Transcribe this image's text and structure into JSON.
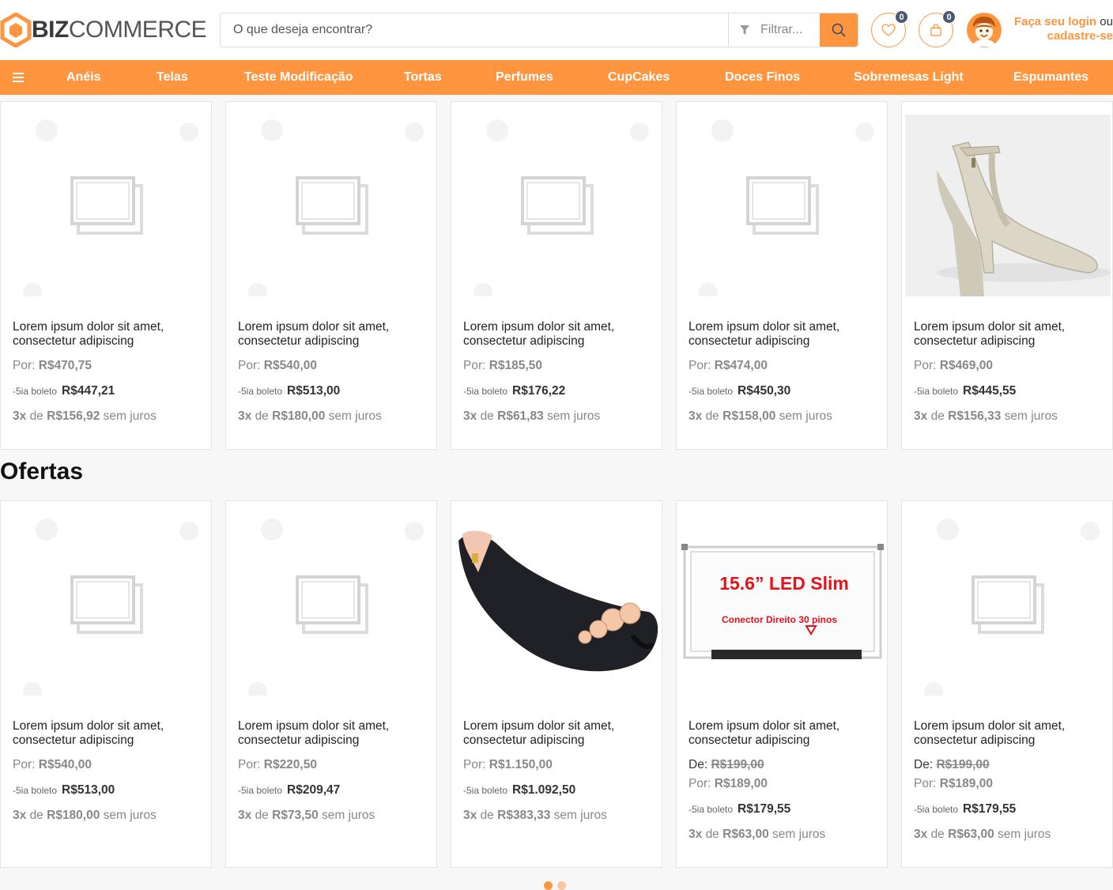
{
  "header": {
    "logo": {
      "bold": "BIZ",
      "light": "COMMERCE"
    },
    "search_placeholder": "O que deseja encontrar?",
    "filter_label": "Filtrar...",
    "wishlist_count": "0",
    "cart_count": "0",
    "login_link": "Faça seu login",
    "login_or": " ou",
    "register_link": "cadastre-se"
  },
  "nav": {
    "items": [
      "Anéis",
      "Telas",
      "Teste Modificação",
      "Tortas",
      "Perfumes",
      "CupCakes",
      "Doces Finos",
      "Sobremesas Light",
      "Espumantes"
    ]
  },
  "row1": [
    {
      "title": "Lorem ipsum dolor sit amet, consectetur adipiscing",
      "por_label": "Por:",
      "por": "R$470,75",
      "boleto_label": "-5ia boleto",
      "boleto": "R$447,21",
      "inst_n": "3x",
      "inst_de": "de",
      "inst": "R$156,92",
      "inst_suffix": "sem juros",
      "image": "placeholder"
    },
    {
      "title": "Lorem ipsum dolor sit amet, consectetur adipiscing",
      "por_label": "Por:",
      "por": "R$540,00",
      "boleto_label": "-5ia boleto",
      "boleto": "R$513,00",
      "inst_n": "3x",
      "inst_de": "de",
      "inst": "R$180,00",
      "inst_suffix": "sem juros",
      "image": "placeholder"
    },
    {
      "title": "Lorem ipsum dolor sit amet, consectetur adipiscing",
      "por_label": "Por:",
      "por": "R$185,50",
      "boleto_label": "-5ia boleto",
      "boleto": "R$176,22",
      "inst_n": "3x",
      "inst_de": "de",
      "inst": "R$61,83",
      "inst_suffix": "sem juros",
      "image": "placeholder"
    },
    {
      "title": "Lorem ipsum dolor sit amet, consectetur adipiscing",
      "por_label": "Por:",
      "por": "R$474,00",
      "boleto_label": "-5ia boleto",
      "boleto": "R$450,30",
      "inst_n": "3x",
      "inst_de": "de",
      "inst": "R$158,00",
      "inst_suffix": "sem juros",
      "image": "placeholder"
    },
    {
      "title": "Lorem ipsum dolor sit amet, consectetur adipiscing",
      "por_label": "Por:",
      "por": "R$469,00",
      "boleto_label": "-5ia boleto",
      "boleto": "R$445,55",
      "inst_n": "3x",
      "inst_de": "de",
      "inst": "R$156,33",
      "inst_suffix": "sem juros",
      "image": "sandal"
    }
  ],
  "offers": {
    "title": "Ofertas",
    "items": [
      {
        "title": "Lorem ipsum dolor sit amet, consectetur adipiscing",
        "por_label": "Por:",
        "por": "R$540,00",
        "boleto_label": "-5ia boleto",
        "boleto": "R$513,00",
        "inst_n": "3x",
        "inst_de": "de",
        "inst": "R$180,00",
        "inst_suffix": "sem juros",
        "image": "placeholder"
      },
      {
        "title": "Lorem ipsum dolor sit amet, consectetur adipiscing",
        "por_label": "Por:",
        "por": "R$220,50",
        "boleto_label": "-5ia boleto",
        "boleto": "R$209,47",
        "inst_n": "3x",
        "inst_de": "de",
        "inst": "R$73,50",
        "inst_suffix": "sem juros",
        "image": "placeholder"
      },
      {
        "title": "Lorem ipsum dolor sit amet, consectetur adipiscing",
        "por_label": "Por:",
        "por": "R$1.150,00",
        "boleto_label": "-5ia boleto",
        "boleto": "R$1.092,50",
        "inst_n": "3x",
        "inst_de": "de",
        "inst": "R$383,33",
        "inst_suffix": "sem juros",
        "image": "flat-shoe"
      },
      {
        "title": "Lorem ipsum dolor sit amet, consectetur adipiscing",
        "de_label": "De:",
        "de": "R$199,00",
        "por_label": "Por:",
        "por": "R$189,00",
        "boleto_label": "-5ia boleto",
        "boleto": "R$179,55",
        "inst_n": "3x",
        "inst_de": "de",
        "inst": "R$63,00",
        "inst_suffix": "sem juros",
        "image": "led-screen",
        "image_text_1": "15.6” LED Slim",
        "image_text_2": "Conector Direito 30 pinos"
      },
      {
        "title": "Lorem ipsum dolor sit amet, consectetur adipiscing",
        "de_label": "De:",
        "de": "R$199,00",
        "por_label": "Por:",
        "por": "R$189,00",
        "boleto_label": "-5ia boleto",
        "boleto": "R$179,55",
        "inst_n": "3x",
        "inst_de": "de",
        "inst": "R$63,00",
        "inst_suffix": "sem juros",
        "image": "placeholder"
      }
    ]
  },
  "carousel": {
    "pages": 2,
    "active": 0
  },
  "colors": {
    "accent": "#ff953f",
    "badge": "#4a5872"
  }
}
